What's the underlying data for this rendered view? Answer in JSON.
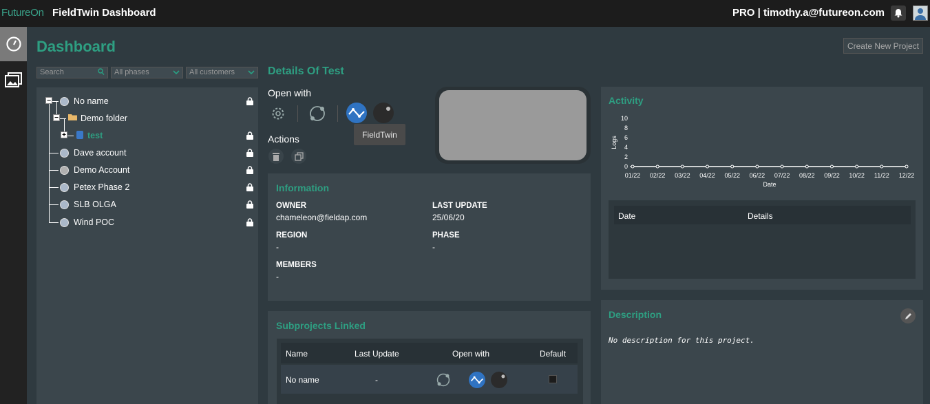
{
  "header": {
    "brand": "FutureOn",
    "app_title": "FieldTwin Dashboard",
    "user": "PRO | timothy.a@futureon.com"
  },
  "page": {
    "title": "Dashboard",
    "create_button": "Create New Project"
  },
  "filters": {
    "search_placeholder": "Search",
    "phases": "All phases",
    "customers": "All customers"
  },
  "tree": [
    {
      "label": "No name",
      "locked": true
    },
    {
      "label": "Demo folder",
      "locked": false
    },
    {
      "label": "test",
      "locked": true
    },
    {
      "label": "Dave account",
      "locked": true
    },
    {
      "label": "Demo Account",
      "locked": true
    },
    {
      "label": "Petex Phase 2",
      "locked": true
    },
    {
      "label": "SLB OLGA",
      "locked": true
    },
    {
      "label": "Wind POC",
      "locked": true
    }
  ],
  "details": {
    "title": "Details Of Test",
    "open_with": "Open with",
    "actions": "Actions",
    "tooltip": "FieldTwin"
  },
  "information": {
    "title": "Information",
    "owner_label": "OWNER",
    "owner": "chameleon@fieldap.com",
    "last_update_label": "LAST UPDATE",
    "last_update": "25/06/20",
    "region_label": "REGION",
    "region": "-",
    "phase_label": "PHASE",
    "phase": "-",
    "members_label": "MEMBERS",
    "members": "-"
  },
  "subprojects": {
    "title": "Subprojects Linked",
    "columns": [
      "Name",
      "Last Update",
      "Open with",
      "Default"
    ],
    "rows": [
      {
        "name": "No name",
        "last_update": "-"
      }
    ]
  },
  "activity": {
    "title": "Activity",
    "table_columns": [
      "Date",
      "Details"
    ]
  },
  "description": {
    "title": "Description",
    "text": "No description for this project."
  },
  "chart_data": {
    "type": "line",
    "title": "",
    "xlabel": "Date",
    "ylabel": "Logs",
    "categories": [
      "01/22",
      "02/22",
      "03/22",
      "04/22",
      "05/22",
      "06/22",
      "07/22",
      "08/22",
      "09/22",
      "10/22",
      "11/22",
      "12/22"
    ],
    "series": [
      {
        "values": [
          0,
          0,
          0,
          0,
          0,
          0,
          0,
          0,
          0,
          0,
          0,
          0
        ]
      }
    ],
    "y_ticks": [
      0,
      2,
      4,
      6,
      8,
      10
    ],
    "ylim": [
      0,
      10
    ],
    "color": "#ffffff"
  }
}
